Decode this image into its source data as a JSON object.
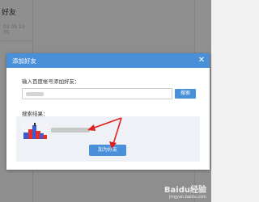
{
  "background": {
    "title": "好友",
    "subtitle": "03 05 23 35"
  },
  "dialog": {
    "title": "添加好友",
    "input_label": "输入百度帐号添加好友：",
    "input_value": "",
    "search_button": "搜索",
    "result_label": "搜索结果：",
    "add_button": "加为好友"
  },
  "watermark": {
    "main": "Baidu经验",
    "sub": "jingyan.baidu.com"
  },
  "colors": {
    "accent": "#4a90d9",
    "arrow": "#e02020"
  }
}
